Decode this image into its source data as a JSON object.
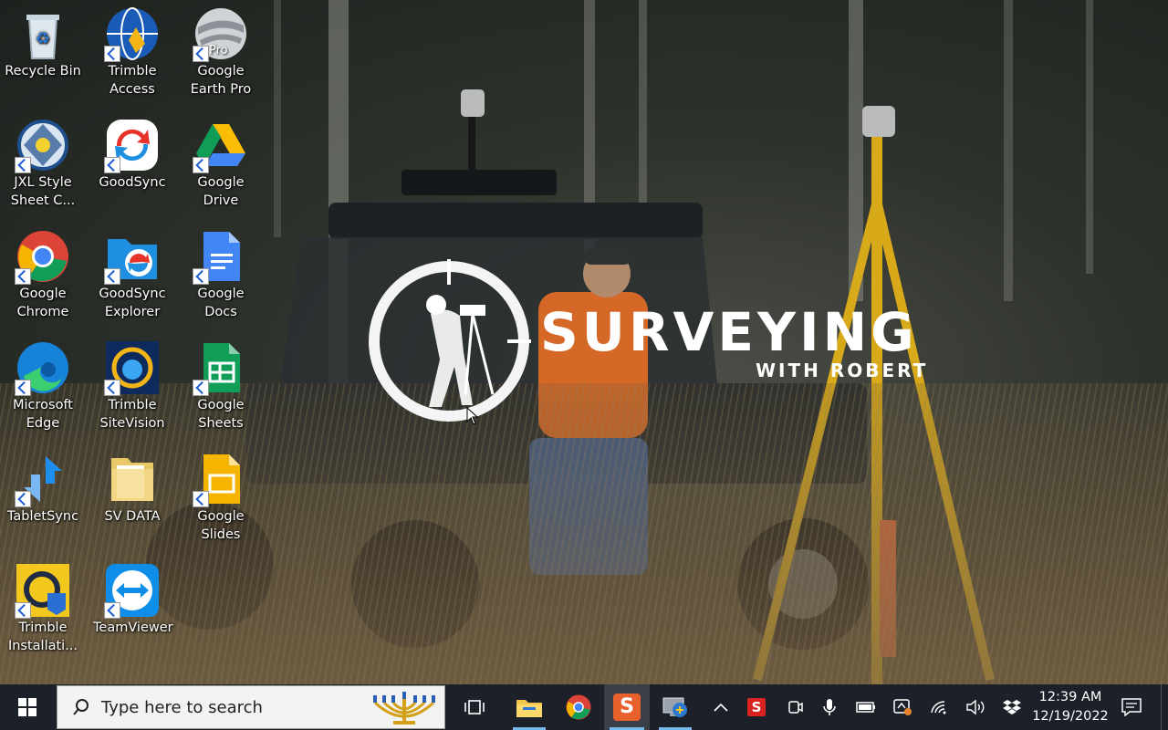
{
  "desktop": {
    "icons": [
      {
        "id": "recycle-bin",
        "label": "Recycle Bin"
      },
      {
        "id": "trimble-access",
        "label": "Trimble Access"
      },
      {
        "id": "google-earth-pro",
        "label": "Google Earth Pro",
        "badge": "Pro"
      },
      {
        "id": "jxl-style-sheet",
        "label": "JXL Style Sheet C..."
      },
      {
        "id": "goodsync",
        "label": "GoodSync"
      },
      {
        "id": "google-drive",
        "label": "Google Drive"
      },
      {
        "id": "google-chrome",
        "label": "Google Chrome"
      },
      {
        "id": "goodsync-explorer",
        "label": "GoodSync Explorer"
      },
      {
        "id": "google-docs",
        "label": "Google Docs"
      },
      {
        "id": "microsoft-edge",
        "label": "Microsoft Edge"
      },
      {
        "id": "trimble-sitevision",
        "label": "Trimble SiteVision"
      },
      {
        "id": "google-sheets",
        "label": "Google Sheets"
      },
      {
        "id": "tabletsync",
        "label": "TabletSync"
      },
      {
        "id": "sv-data",
        "label": "SV DATA"
      },
      {
        "id": "google-slides",
        "label": "Google Slides"
      },
      {
        "id": "trimble-installation",
        "label": "Trimble Installati..."
      },
      {
        "id": "teamviewer",
        "label": "TeamViewer"
      }
    ]
  },
  "wallpaper": {
    "title": "SURVEYING",
    "subtitle": "WITH ROBERT"
  },
  "taskbar": {
    "search_placeholder": "Type here to search",
    "clock_time": "12:39 AM",
    "clock_date": "12/19/2022",
    "accent": "#76b9ed"
  }
}
